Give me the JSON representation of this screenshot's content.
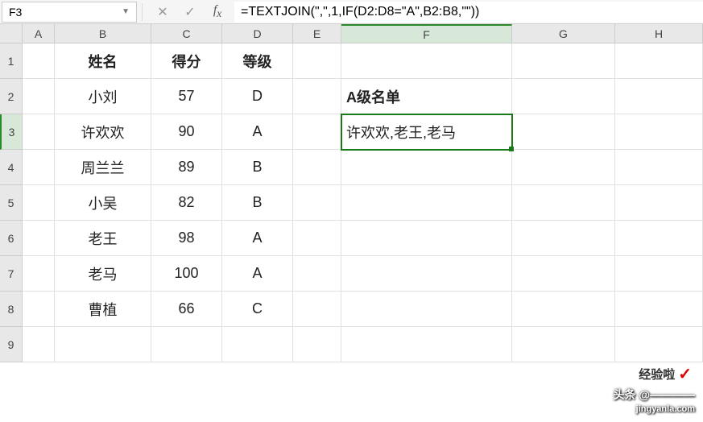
{
  "name_box": "F3",
  "formula": "=TEXTJOIN(\",\",1,IF(D2:D8=\"A\",B2:B8,\"\"))",
  "col_headers": [
    "A",
    "B",
    "C",
    "D",
    "E",
    "F",
    "G",
    "H"
  ],
  "row_headers": [
    "1",
    "2",
    "3",
    "4",
    "5",
    "6",
    "7",
    "8",
    "9"
  ],
  "header_row": {
    "name": "姓名",
    "score": "得分",
    "grade": "等级"
  },
  "rows": [
    {
      "name": "小刘",
      "score": "57",
      "grade": "D"
    },
    {
      "name": "许欢欢",
      "score": "90",
      "grade": "A"
    },
    {
      "name": "周兰兰",
      "score": "89",
      "grade": "B"
    },
    {
      "name": "小吴",
      "score": "82",
      "grade": "B"
    },
    {
      "name": "老王",
      "score": "98",
      "grade": "A"
    },
    {
      "name": "老马",
      "score": "100",
      "grade": "A"
    },
    {
      "name": "曹植",
      "score": "66",
      "grade": "C"
    }
  ],
  "f2_label": "A级名单",
  "f3_result": "许欢欢,老王,老马",
  "watermark": {
    "line1": "头条 @————",
    "line2": "经验啦",
    "site": "jingyanla.com"
  },
  "active_col": "F",
  "active_row": "3"
}
